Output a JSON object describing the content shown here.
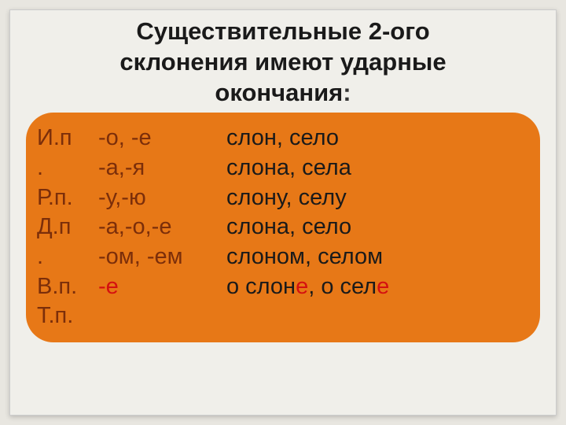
{
  "title_line1": "Существительные 2-ого",
  "title_line2": "склонения имеют ударные",
  "title_line3": "окончания",
  "title_colon": ":",
  "cases": {
    "ip": "И.п",
    "ip_dot": ".",
    "rp": "Р.п.",
    "dp": "Д.п",
    "dp_dot": ".",
    "vp": "В.п.",
    "tp": "Т.п."
  },
  "endings": {
    "r1": "-о, -е",
    "r2": "-а,-я",
    "r3": "-у,-ю",
    "r4": "-а,-о,-е",
    "r5": "-ом, -ем",
    "r6": "-е"
  },
  "examples": {
    "r1": "слон, село",
    "r2": "слона, села",
    "r3": "слону, селу",
    "r4": "слона, село",
    "r5": "слоном, селом",
    "r6a": "о слон",
    "r6b": "е",
    "r6c": ", о сел",
    "r6d": "е"
  }
}
